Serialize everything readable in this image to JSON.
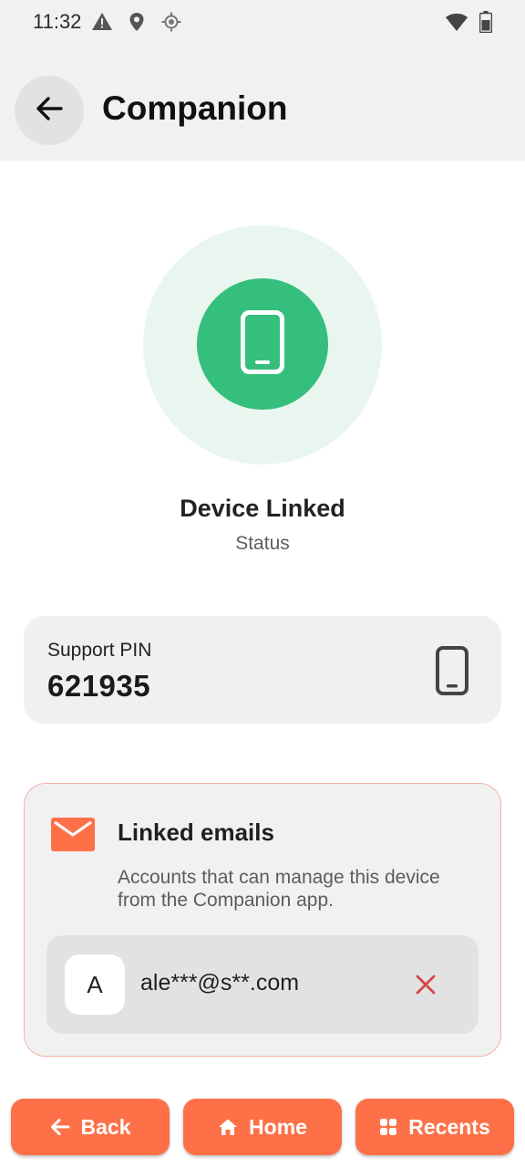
{
  "status_bar": {
    "time": "11:32",
    "left_icons": [
      "warning-icon",
      "location-pin-icon",
      "gps-icon"
    ],
    "right_icons": [
      "wifi-icon",
      "battery-icon"
    ]
  },
  "app_bar": {
    "title": "Companion",
    "back_icon": "arrow-left-icon"
  },
  "device": {
    "status_value": "Device Linked",
    "status_label": "Status",
    "icon": "smartphone-icon",
    "colors": {
      "accent": "#35bf7c",
      "halo": "#e8f6ef"
    }
  },
  "support": {
    "label": "Support PIN",
    "pin": "621935",
    "icon": "smartphone-icon"
  },
  "linked_emails": {
    "title": "Linked emails",
    "description": "Accounts that can manage this device from the Companion app.",
    "icon": "mail-icon",
    "emails": [
      {
        "avatar": "A",
        "address": "ale***@s**.com",
        "remove_icon": "close-icon"
      }
    ],
    "colors": {
      "icon": "#fe7148",
      "remove": "#d64545",
      "border": "#f2b3a3"
    }
  },
  "nav": {
    "back_label": "Back",
    "home_label": "Home",
    "recents_label": "Recents",
    "color": "#fe7148"
  }
}
